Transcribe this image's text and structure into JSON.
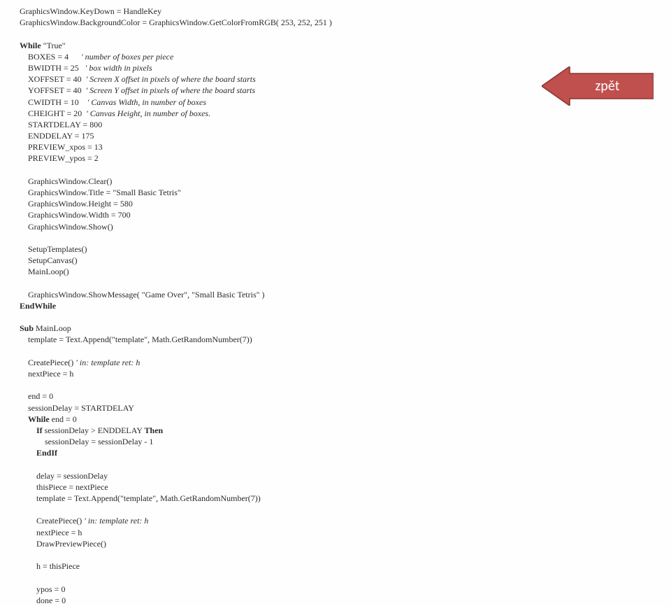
{
  "back_button": {
    "label": "zpět"
  },
  "lines": [
    {
      "indent": 0,
      "segs": [
        {
          "t": "GraphicsWindow.KeyDown = HandleKey"
        }
      ]
    },
    {
      "indent": 0,
      "segs": [
        {
          "t": "GraphicsWindow.BackgroundColor = GraphicsWindow.GetColorFromRGB( 253, 252, 251 )"
        }
      ]
    },
    {
      "indent": 0,
      "segs": [
        {
          "t": " "
        }
      ]
    },
    {
      "indent": 0,
      "segs": [
        {
          "t": "While",
          "b": true
        },
        {
          "t": " \"True\""
        }
      ]
    },
    {
      "indent": 1,
      "segs": [
        {
          "t": "BOXES = 4      "
        },
        {
          "t": "' number of boxes per piece",
          "c": true
        }
      ]
    },
    {
      "indent": 1,
      "segs": [
        {
          "t": "BWIDTH = 25   "
        },
        {
          "t": "' box width in pixels",
          "c": true
        }
      ]
    },
    {
      "indent": 1,
      "segs": [
        {
          "t": "XOFFSET = 40  "
        },
        {
          "t": "' Screen X offset in pixels of where the board starts",
          "c": true
        }
      ]
    },
    {
      "indent": 1,
      "segs": [
        {
          "t": "YOFFSET = 40  "
        },
        {
          "t": "' Screen Y offset in pixels of where the board starts",
          "c": true
        }
      ]
    },
    {
      "indent": 1,
      "segs": [
        {
          "t": "CWIDTH = 10    "
        },
        {
          "t": "' Canvas Width, in number of boxes",
          "c": true
        }
      ]
    },
    {
      "indent": 1,
      "segs": [
        {
          "t": "CHEIGHT = 20  "
        },
        {
          "t": "' Canvas Height, in number of boxes.",
          "c": true
        }
      ]
    },
    {
      "indent": 1,
      "segs": [
        {
          "t": "STARTDELAY = 800"
        }
      ]
    },
    {
      "indent": 1,
      "segs": [
        {
          "t": "ENDDELAY = 175"
        }
      ]
    },
    {
      "indent": 1,
      "segs": [
        {
          "t": "PREVIEW_xpos = 13"
        }
      ]
    },
    {
      "indent": 1,
      "segs": [
        {
          "t": "PREVIEW_ypos = 2"
        }
      ]
    },
    {
      "indent": 0,
      "segs": [
        {
          "t": " "
        }
      ]
    },
    {
      "indent": 1,
      "segs": [
        {
          "t": "GraphicsWindow.Clear()"
        }
      ]
    },
    {
      "indent": 1,
      "segs": [
        {
          "t": "GraphicsWindow.Title = \"Small Basic Tetris\""
        }
      ]
    },
    {
      "indent": 1,
      "segs": [
        {
          "t": "GraphicsWindow.Height = 580"
        }
      ]
    },
    {
      "indent": 1,
      "segs": [
        {
          "t": "GraphicsWindow.Width = 700"
        }
      ]
    },
    {
      "indent": 1,
      "segs": [
        {
          "t": "GraphicsWindow.Show()"
        }
      ]
    },
    {
      "indent": 0,
      "segs": [
        {
          "t": " "
        }
      ]
    },
    {
      "indent": 1,
      "segs": [
        {
          "t": "SetupTemplates()"
        }
      ]
    },
    {
      "indent": 1,
      "segs": [
        {
          "t": "SetupCanvas()"
        }
      ]
    },
    {
      "indent": 1,
      "segs": [
        {
          "t": "MainLoop()"
        }
      ]
    },
    {
      "indent": 0,
      "segs": [
        {
          "t": " "
        }
      ]
    },
    {
      "indent": 1,
      "segs": [
        {
          "t": "GraphicsWindow.ShowMessage( \"Game Over\", \"Small Basic Tetris\" )"
        }
      ]
    },
    {
      "indent": 0,
      "segs": [
        {
          "t": "EndWhile",
          "b": true
        }
      ]
    },
    {
      "indent": 0,
      "segs": [
        {
          "t": " "
        }
      ]
    },
    {
      "indent": 0,
      "segs": [
        {
          "t": "Sub",
          "b": true
        },
        {
          "t": " MainLoop"
        }
      ]
    },
    {
      "indent": 1,
      "segs": [
        {
          "t": "template = Text.Append(\"template\", Math.GetRandomNumber(7))"
        }
      ]
    },
    {
      "indent": 0,
      "segs": [
        {
          "t": " "
        }
      ]
    },
    {
      "indent": 1,
      "segs": [
        {
          "t": "CreatePiece() "
        },
        {
          "t": "' in: template ret: h",
          "c": true
        }
      ]
    },
    {
      "indent": 1,
      "segs": [
        {
          "t": "nextPiece = h"
        }
      ]
    },
    {
      "indent": 0,
      "segs": [
        {
          "t": " "
        }
      ]
    },
    {
      "indent": 1,
      "segs": [
        {
          "t": "end = 0"
        }
      ]
    },
    {
      "indent": 1,
      "segs": [
        {
          "t": "sessionDelay = STARTDELAY"
        }
      ]
    },
    {
      "indent": 1,
      "segs": [
        {
          "t": "While",
          "b": true
        },
        {
          "t": " end = 0"
        }
      ]
    },
    {
      "indent": 2,
      "segs": [
        {
          "t": "If",
          "b": true
        },
        {
          "t": " sessionDelay > ENDDELAY "
        },
        {
          "t": "Then",
          "b": true
        }
      ]
    },
    {
      "indent": 3,
      "segs": [
        {
          "t": "sessionDelay = sessionDelay - 1"
        }
      ]
    },
    {
      "indent": 2,
      "segs": [
        {
          "t": "EndIf",
          "b": true
        }
      ]
    },
    {
      "indent": 0,
      "segs": [
        {
          "t": " "
        }
      ]
    },
    {
      "indent": 2,
      "segs": [
        {
          "t": "delay = sessionDelay"
        }
      ]
    },
    {
      "indent": 2,
      "segs": [
        {
          "t": "thisPiece = nextPiece"
        }
      ]
    },
    {
      "indent": 2,
      "segs": [
        {
          "t": "template = Text.Append(\"template\", Math.GetRandomNumber(7))"
        }
      ]
    },
    {
      "indent": 0,
      "segs": [
        {
          "t": " "
        }
      ]
    },
    {
      "indent": 2,
      "segs": [
        {
          "t": "CreatePiece() "
        },
        {
          "t": "' in: template ret: h",
          "c": true
        }
      ]
    },
    {
      "indent": 2,
      "segs": [
        {
          "t": "nextPiece = h"
        }
      ]
    },
    {
      "indent": 2,
      "segs": [
        {
          "t": "DrawPreviewPiece()"
        }
      ]
    },
    {
      "indent": 0,
      "segs": [
        {
          "t": " "
        }
      ]
    },
    {
      "indent": 2,
      "segs": [
        {
          "t": "h = thisPiece"
        }
      ]
    },
    {
      "indent": 0,
      "segs": [
        {
          "t": " "
        }
      ]
    },
    {
      "indent": 2,
      "segs": [
        {
          "t": "ypos = 0"
        }
      ]
    },
    {
      "indent": 2,
      "segs": [
        {
          "t": "done = 0"
        }
      ]
    }
  ]
}
